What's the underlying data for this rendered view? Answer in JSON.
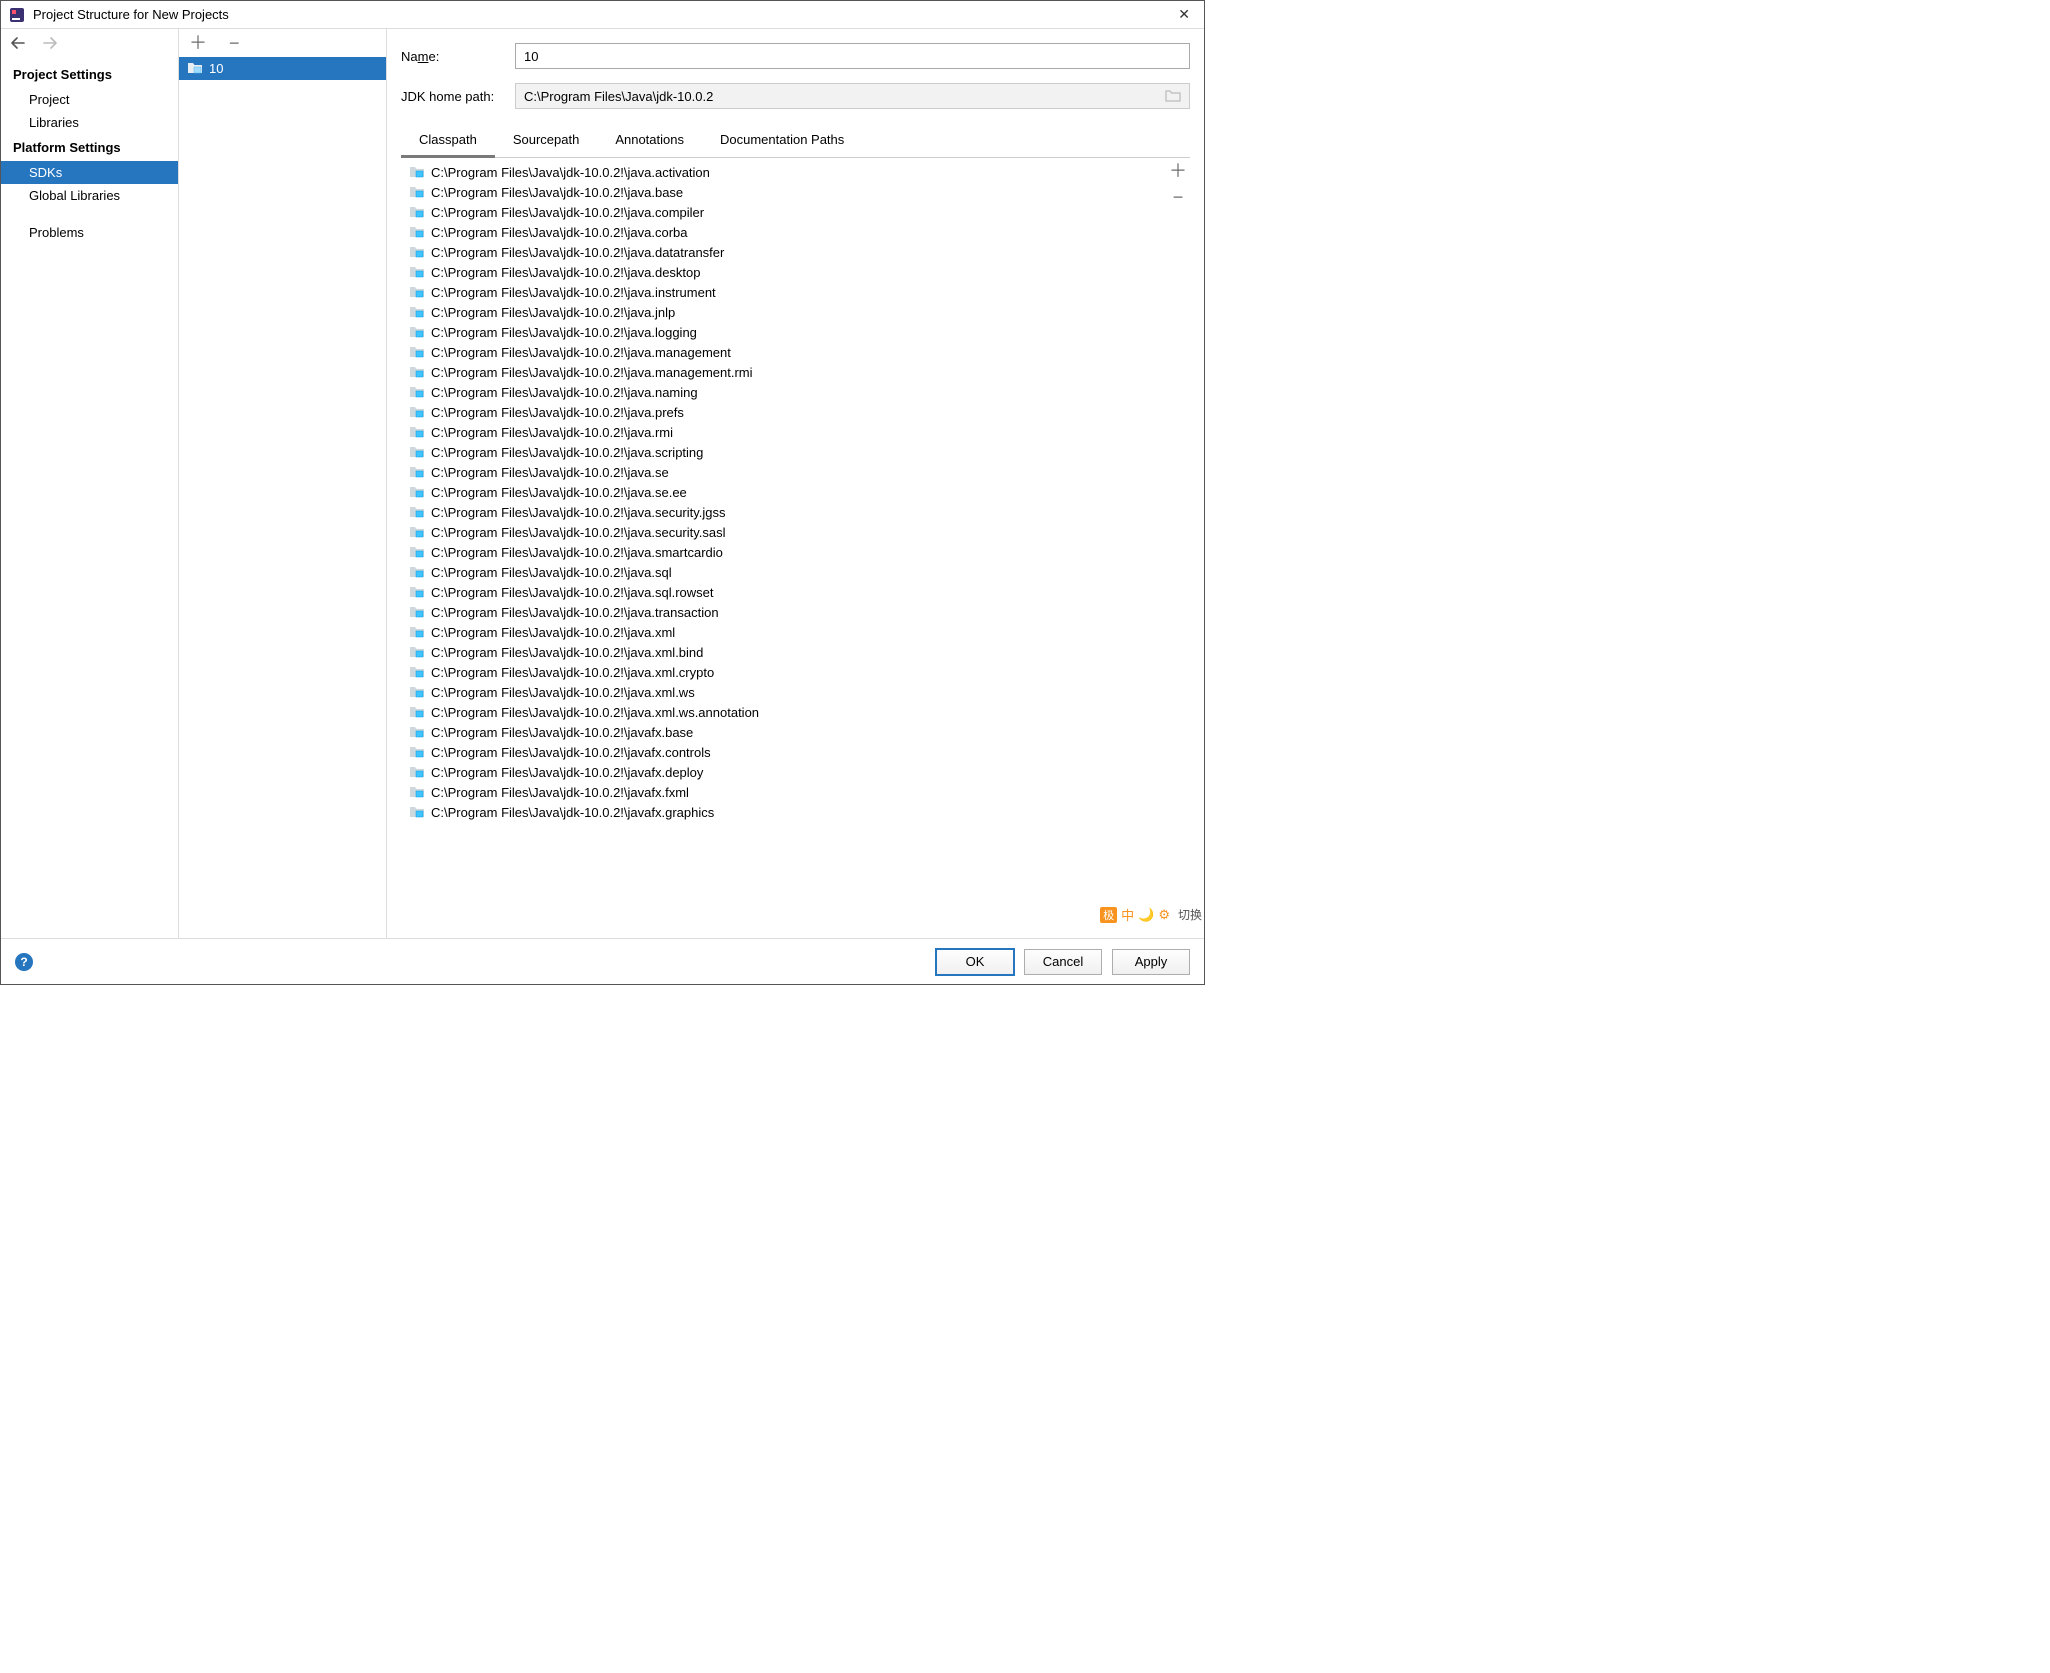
{
  "titlebar": {
    "title": "Project Structure for New Projects"
  },
  "leftnav": {
    "groups": [
      {
        "head": "Project Settings",
        "items": [
          {
            "label": "Project",
            "selected": false
          },
          {
            "label": "Libraries",
            "selected": false
          }
        ]
      },
      {
        "head": "Platform Settings",
        "items": [
          {
            "label": "SDKs",
            "selected": true
          },
          {
            "label": "Global Libraries",
            "selected": false
          }
        ]
      }
    ],
    "problems": {
      "label": "Problems"
    }
  },
  "sdk_list": {
    "items": [
      {
        "label": "10",
        "selected": true
      }
    ]
  },
  "form": {
    "name_label_pre": "Na",
    "name_label_u": "m",
    "name_label_post": "e:",
    "name_value": "10",
    "path_label": "JDK home path:",
    "path_value": "C:\\Program Files\\Java\\jdk-10.0.2"
  },
  "tabs": {
    "items": [
      {
        "label": "Classpath",
        "active": true
      },
      {
        "label": "Sourcepath",
        "active": false
      },
      {
        "label": "Annotations",
        "active": false
      },
      {
        "label": "Documentation Paths",
        "active": false
      }
    ]
  },
  "classpath": {
    "items": [
      "C:\\Program Files\\Java\\jdk-10.0.2!\\java.activation",
      "C:\\Program Files\\Java\\jdk-10.0.2!\\java.base",
      "C:\\Program Files\\Java\\jdk-10.0.2!\\java.compiler",
      "C:\\Program Files\\Java\\jdk-10.0.2!\\java.corba",
      "C:\\Program Files\\Java\\jdk-10.0.2!\\java.datatransfer",
      "C:\\Program Files\\Java\\jdk-10.0.2!\\java.desktop",
      "C:\\Program Files\\Java\\jdk-10.0.2!\\java.instrument",
      "C:\\Program Files\\Java\\jdk-10.0.2!\\java.jnlp",
      "C:\\Program Files\\Java\\jdk-10.0.2!\\java.logging",
      "C:\\Program Files\\Java\\jdk-10.0.2!\\java.management",
      "C:\\Program Files\\Java\\jdk-10.0.2!\\java.management.rmi",
      "C:\\Program Files\\Java\\jdk-10.0.2!\\java.naming",
      "C:\\Program Files\\Java\\jdk-10.0.2!\\java.prefs",
      "C:\\Program Files\\Java\\jdk-10.0.2!\\java.rmi",
      "C:\\Program Files\\Java\\jdk-10.0.2!\\java.scripting",
      "C:\\Program Files\\Java\\jdk-10.0.2!\\java.se",
      "C:\\Program Files\\Java\\jdk-10.0.2!\\java.se.ee",
      "C:\\Program Files\\Java\\jdk-10.0.2!\\java.security.jgss",
      "C:\\Program Files\\Java\\jdk-10.0.2!\\java.security.sasl",
      "C:\\Program Files\\Java\\jdk-10.0.2!\\java.smartcardio",
      "C:\\Program Files\\Java\\jdk-10.0.2!\\java.sql",
      "C:\\Program Files\\Java\\jdk-10.0.2!\\java.sql.rowset",
      "C:\\Program Files\\Java\\jdk-10.0.2!\\java.transaction",
      "C:\\Program Files\\Java\\jdk-10.0.2!\\java.xml",
      "C:\\Program Files\\Java\\jdk-10.0.2!\\java.xml.bind",
      "C:\\Program Files\\Java\\jdk-10.0.2!\\java.xml.crypto",
      "C:\\Program Files\\Java\\jdk-10.0.2!\\java.xml.ws",
      "C:\\Program Files\\Java\\jdk-10.0.2!\\java.xml.ws.annotation",
      "C:\\Program Files\\Java\\jdk-10.0.2!\\javafx.base",
      "C:\\Program Files\\Java\\jdk-10.0.2!\\javafx.controls",
      "C:\\Program Files\\Java\\jdk-10.0.2!\\javafx.deploy",
      "C:\\Program Files\\Java\\jdk-10.0.2!\\javafx.fxml",
      "C:\\Program Files\\Java\\jdk-10.0.2!\\javafx.graphics"
    ]
  },
  "footer": {
    "ok": "OK",
    "cancel": "Cancel",
    "apply": "Apply"
  },
  "ime": {
    "badge": "极",
    "ch": "中",
    "moon": "🌙",
    "set": "⚙",
    "switch": "切换"
  }
}
